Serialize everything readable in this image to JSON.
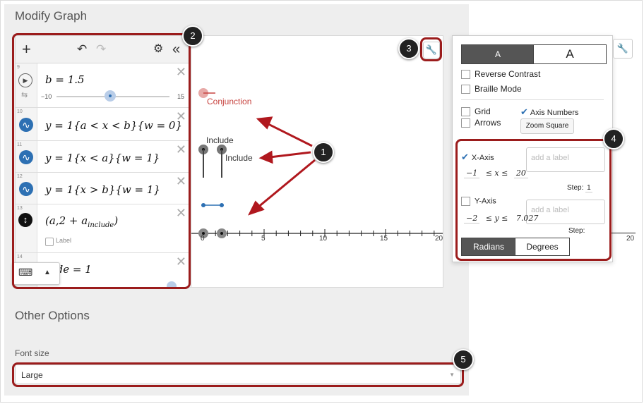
{
  "page": {
    "title": "Modify Graph",
    "other_options_title": "Other Options",
    "font_size_label": "Font size",
    "font_size_value": "Large"
  },
  "expressions": [
    {
      "num": "9",
      "text": "b = 1.5",
      "slider_min": "−10",
      "slider_max": "15"
    },
    {
      "num": "10",
      "text": "y = 1{a < x < b}{w = 0}"
    },
    {
      "num": "11",
      "text": "y = 1{x < a}{w = 1}"
    },
    {
      "num": "12",
      "text": "y = 1{x > b}{w = 1}"
    },
    {
      "num": "13",
      "text": "(a,2 + a",
      "sub": "include",
      "close": ")",
      "label_checkbox": "Label"
    },
    {
      "num": "14",
      "text": "ude = 1"
    }
  ],
  "graph": {
    "label_conjunction": "Conjunction",
    "label_include_1": "Include",
    "label_include_2": "Include",
    "x_ticks": [
      "0",
      "5",
      "10",
      "15",
      "20"
    ]
  },
  "settings": {
    "size_small": "A",
    "size_large": "A",
    "reverse_contrast": "Reverse Contrast",
    "braille_mode": "Braille Mode",
    "grid": "Grid",
    "axis_numbers": "Axis Numbers",
    "arrows": "Arrows",
    "zoom_square": "Zoom Square",
    "x_axis": "X-Axis",
    "x_label_placeholder": "add a label",
    "x_min": "−1",
    "x_mid": "≤ x ≤",
    "x_max": "20",
    "x_step_label": "Step:",
    "x_step": "1",
    "y_axis": "Y-Axis",
    "y_label_placeholder": "add a label",
    "y_min": "−2",
    "y_mid": "≤ y ≤",
    "y_max": "7.027",
    "y_step_label": "Step:",
    "right_tick": "20",
    "radians": "Radians",
    "degrees": "Degrees"
  },
  "badges": [
    "1",
    "2",
    "3",
    "4",
    "5"
  ],
  "colors": {
    "red_annotation": "#9b1c1c",
    "conjunction": "#c74440",
    "blue": "#2d70b3",
    "point_gray": "#555555"
  }
}
